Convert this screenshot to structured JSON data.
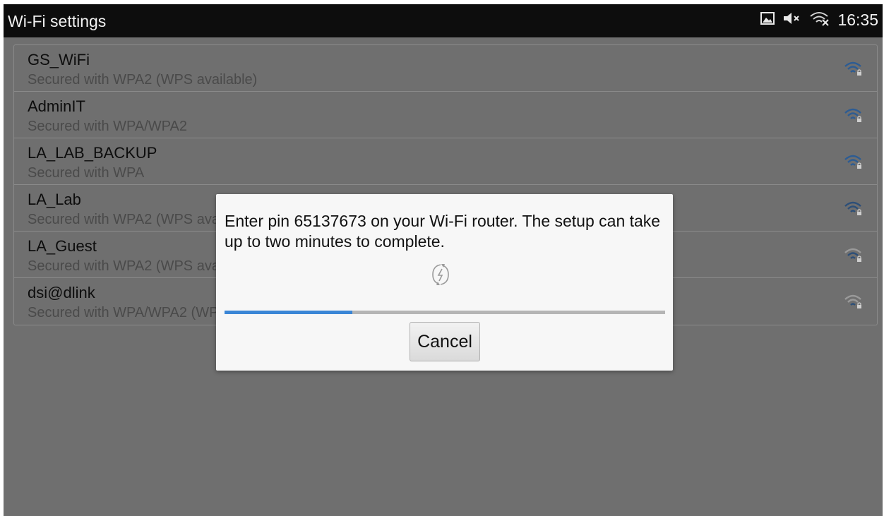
{
  "status_bar": {
    "title": "Wi-Fi settings",
    "time": "16:35",
    "icons": [
      "gallery-icon",
      "mute-icon",
      "wifi-off-icon"
    ]
  },
  "networks": [
    {
      "name": "GS_WiFi",
      "security": "Secured with WPA2 (WPS available)",
      "signal_icon": "wifi-locked-icon"
    },
    {
      "name": "AdminIT",
      "security": "Secured with WPA/WPA2",
      "signal_icon": "wifi-locked-icon"
    },
    {
      "name": "LA_LAB_BACKUP",
      "security": "Secured with WPA",
      "signal_icon": "wifi-locked-icon"
    },
    {
      "name": "LA_Lab",
      "security": "Secured with WPA2 (WPS available)",
      "signal_icon": "wifi-locked-icon"
    },
    {
      "name": "LA_Guest",
      "security": "Secured with WPA2 (WPS available)",
      "signal_icon": "wifi-locked-icon"
    },
    {
      "name": "dsi@dlink",
      "security": "Secured with WPA/WPA2 (WPS available)",
      "signal_icon": "wifi-locked-icon"
    }
  ],
  "dialog": {
    "message": "Enter pin 65137673 on your Wi-Fi router. The setup can take up to two minutes to complete.",
    "spinner_icon": "wps-spinner-icon",
    "progress": 0.29,
    "cancel_label": "Cancel"
  },
  "colors": {
    "status_bar_bg": "#0d0d0d",
    "dimmed_bg": "#6f6f6f",
    "signal_blue": "#2d5c93",
    "progress_blue": "#3a86d6",
    "dialog_bg": "#f7f7f7"
  }
}
